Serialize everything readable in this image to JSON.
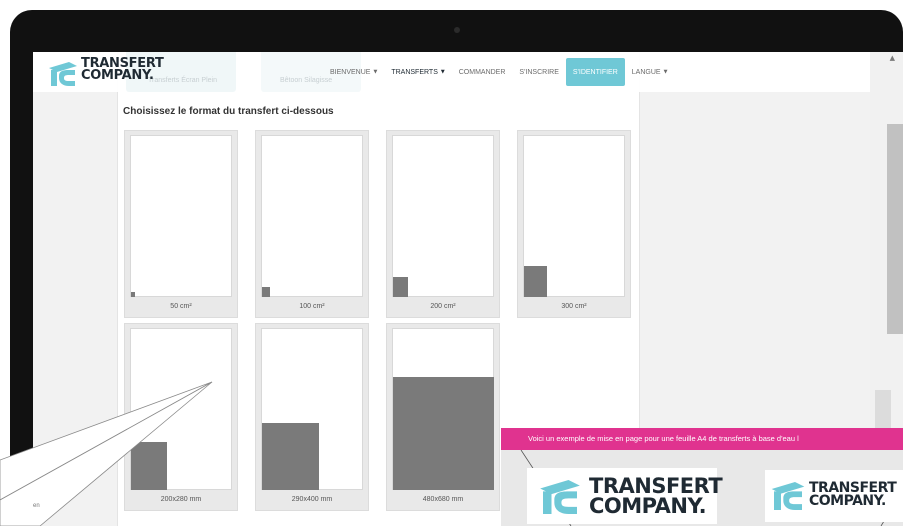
{
  "brand": {
    "logo_line1": "TRANSFERT",
    "logo_line2": "COMPANY.",
    "accent_color": "#6fc8d6",
    "popup_color": "#e0338f"
  },
  "nav": {
    "items": [
      {
        "label": "BIENVENUE",
        "dropdown": true
      },
      {
        "label": "TRANSFERTS",
        "dropdown": true
      },
      {
        "label": "COMMANDER",
        "dropdown": false
      },
      {
        "label": "S'INSCRIRE",
        "dropdown": false
      },
      {
        "label": "S'IDENTIFIER",
        "dropdown": false
      },
      {
        "label": "LANGUE",
        "dropdown": true
      }
    ],
    "background_ghost": {
      "left": "Transferts Écran Plein",
      "middle": "Bêtoon Silagisse"
    }
  },
  "main": {
    "title": "Choisissez le format du transfert ci-dessous",
    "formats": [
      {
        "label": "50 cm²"
      },
      {
        "label": "100 cm²"
      },
      {
        "label": "200 cm²"
      },
      {
        "label": "300 cm²"
      },
      {
        "label": "200x280 mm"
      },
      {
        "label": "290x400 mm"
      },
      {
        "label": "480x680 mm"
      }
    ]
  },
  "popup": {
    "header": "Voici un exemple de mise en page pour une feuille A4 de transferts à base d'eau l"
  },
  "corner_text": "en"
}
